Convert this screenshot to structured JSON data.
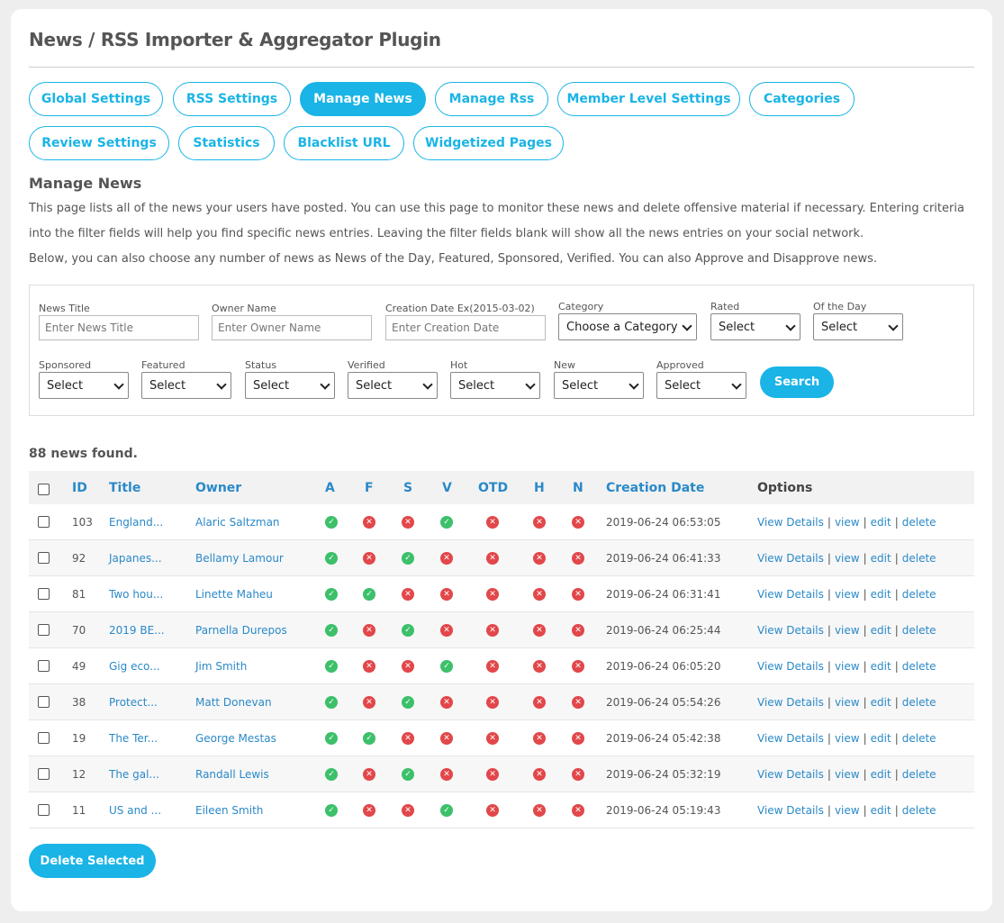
{
  "page": {
    "title": "News / RSS Importer & Aggregator Plugin"
  },
  "tabs": [
    {
      "label": "Global Settings"
    },
    {
      "label": "RSS Settings"
    },
    {
      "label": "Manage News"
    },
    {
      "label": "Manage Rss"
    },
    {
      "label": "Member Level Settings"
    },
    {
      "label": "Categories"
    },
    {
      "label": "Review Settings"
    },
    {
      "label": "Statistics"
    },
    {
      "label": "Blacklist URL"
    },
    {
      "label": "Widgetized Pages"
    }
  ],
  "section": {
    "title": "Manage News",
    "desc1": "This page lists all of the news your users have posted. You can use this page to monitor these news and delete offensive material if necessary. Entering criteria into the filter fields will help you find specific news entries. Leaving the filter fields blank will show all the news entries on your social network.",
    "desc2": "Below, you can also choose any number of news as News of the Day, Featured, Sponsored, Verified. You can also Approve and Disapprove news."
  },
  "filters": {
    "news_title": {
      "label": "News Title",
      "placeholder": "Enter News Title"
    },
    "owner_name": {
      "label": "Owner Name",
      "placeholder": "Enter Owner Name"
    },
    "creation_date": {
      "label": "Creation Date Ex(2015-03-02)",
      "placeholder": "Enter Creation Date"
    },
    "category": {
      "label": "Category",
      "value": "Choose a Category"
    },
    "rated": {
      "label": "Rated",
      "value": "Select"
    },
    "of_the_day": {
      "label": "Of the Day",
      "value": "Select"
    },
    "sponsored": {
      "label": "Sponsored",
      "value": "Select"
    },
    "featured": {
      "label": "Featured",
      "value": "Select"
    },
    "status": {
      "label": "Status",
      "value": "Select"
    },
    "verified": {
      "label": "Verified",
      "value": "Select"
    },
    "hot": {
      "label": "Hot",
      "value": "Select"
    },
    "new": {
      "label": "New",
      "value": "Select"
    },
    "approved": {
      "label": "Approved",
      "value": "Select"
    },
    "search_label": "Search"
  },
  "results": {
    "count_text": "88 news found."
  },
  "table": {
    "headers": {
      "id": "ID",
      "title": "Title",
      "owner": "Owner",
      "a": "A",
      "f": "F",
      "s": "S",
      "v": "V",
      "otd": "OTD",
      "h": "H",
      "n": "N",
      "date": "Creation Date",
      "options": "Options"
    },
    "option_labels": {
      "details": "View Details",
      "view": "view",
      "edit": "edit",
      "delete": "delete",
      "sep": "|"
    },
    "rows": [
      {
        "id": "103",
        "title": "England...",
        "owner": "Alaric Saltzman",
        "a": true,
        "f": false,
        "s": false,
        "v": true,
        "otd": false,
        "h": false,
        "n": false,
        "date": "2019-06-24 06:53:05"
      },
      {
        "id": "92",
        "title": "Japanes...",
        "owner": "Bellamy Lamour",
        "a": true,
        "f": false,
        "s": true,
        "v": false,
        "otd": false,
        "h": false,
        "n": false,
        "date": "2019-06-24 06:41:33"
      },
      {
        "id": "81",
        "title": "Two hou...",
        "owner": "Linette Maheu",
        "a": true,
        "f": true,
        "s": false,
        "v": false,
        "otd": false,
        "h": false,
        "n": false,
        "date": "2019-06-24 06:31:41"
      },
      {
        "id": "70",
        "title": "2019 BE...",
        "owner": "Parnella Durepos",
        "a": true,
        "f": false,
        "s": true,
        "v": false,
        "otd": false,
        "h": false,
        "n": false,
        "date": "2019-06-24 06:25:44"
      },
      {
        "id": "49",
        "title": "Gig eco...",
        "owner": "Jim Smith",
        "a": true,
        "f": false,
        "s": false,
        "v": true,
        "otd": false,
        "h": false,
        "n": false,
        "date": "2019-06-24 06:05:20"
      },
      {
        "id": "38",
        "title": "Protect...",
        "owner": "Matt Donevan",
        "a": true,
        "f": false,
        "s": true,
        "v": false,
        "otd": false,
        "h": false,
        "n": false,
        "date": "2019-06-24 05:54:26"
      },
      {
        "id": "19",
        "title": "The Ter...",
        "owner": "George Mestas",
        "a": true,
        "f": true,
        "s": false,
        "v": false,
        "otd": false,
        "h": false,
        "n": false,
        "date": "2019-06-24 05:42:38"
      },
      {
        "id": "12",
        "title": "The gal...",
        "owner": "Randall Lewis",
        "a": true,
        "f": false,
        "s": true,
        "v": false,
        "otd": false,
        "h": false,
        "n": false,
        "date": "2019-06-24 05:32:19"
      },
      {
        "id": "11",
        "title": "US and ...",
        "owner": "Eileen Smith",
        "a": true,
        "f": false,
        "s": false,
        "v": true,
        "otd": false,
        "h": false,
        "n": false,
        "date": "2019-06-24 05:19:43"
      }
    ]
  },
  "actions": {
    "delete_selected": "Delete Selected"
  },
  "icons": {
    "yes": "check-circle-icon",
    "no": "cross-circle-icon"
  },
  "colors": {
    "accent": "#1ab4e6",
    "link": "#2a89c8",
    "yes": "#3cc06a",
    "no": "#e2474a"
  }
}
